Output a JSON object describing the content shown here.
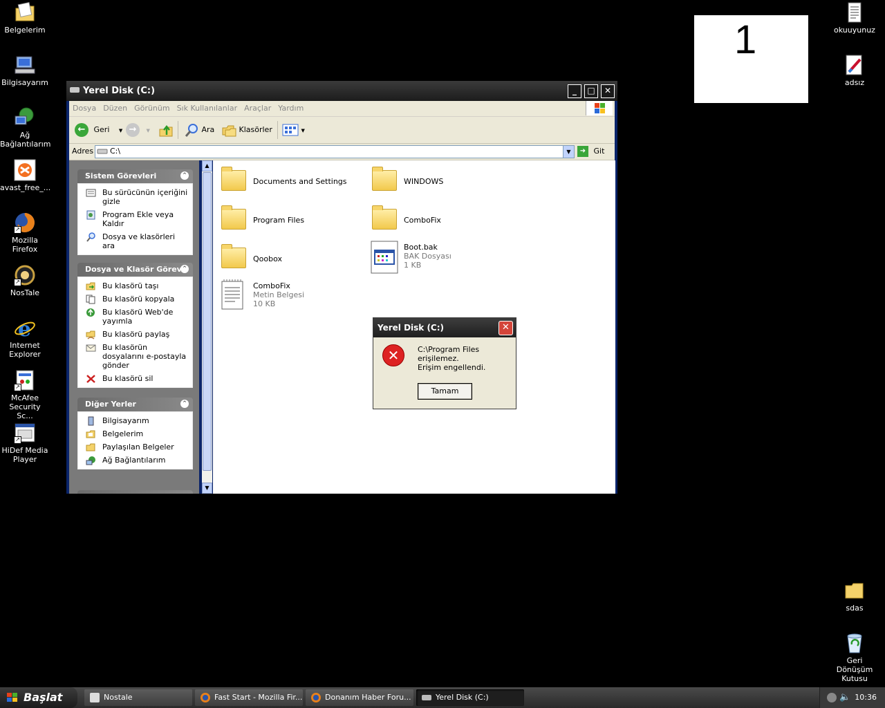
{
  "desktop": {
    "left_icons": [
      {
        "label": "Belgelerim",
        "icon": "my-documents-icon"
      },
      {
        "label": "Bilgisayarım",
        "icon": "my-computer-icon"
      },
      {
        "label": "Ağ Bağlantılarım",
        "icon": "network-icon"
      },
      {
        "label": "avast_free_...",
        "icon": "avast-icon"
      },
      {
        "label": "Mozilla Firefox",
        "icon": "firefox-icon"
      },
      {
        "label": "NosTale",
        "icon": "nostale-icon"
      },
      {
        "label": "Internet Explorer",
        "icon": "ie-icon"
      },
      {
        "label": "McAfee Security Sc...",
        "icon": "mcafee-icon"
      },
      {
        "label": "HiDef Media Player",
        "icon": "media-player-icon"
      }
    ],
    "right_icons": [
      {
        "label": "okuuyunuz",
        "icon": "text-file-icon"
      },
      {
        "label": "adsız",
        "icon": "paint-icon"
      },
      {
        "label": "sdas",
        "icon": "folder-icon"
      },
      {
        "label": "Geri Dönüşüm Kutusu",
        "icon": "recycle-bin-icon"
      }
    ],
    "counter": "1"
  },
  "explorer": {
    "title": "Yerel Disk (C:)",
    "menu": [
      "Dosya",
      "Düzen",
      "Görünüm",
      "Sık Kullanılanlar",
      "Araçlar",
      "Yardım"
    ],
    "toolbar": {
      "back": "Geri",
      "search": "Ara",
      "folders": "Klasörler"
    },
    "address": {
      "label": "Adres",
      "value": "C:\\",
      "go": "Git"
    },
    "panels": [
      {
        "title": "Sistem Görevleri",
        "items": [
          "Bu sürücünün içeriğini gizle",
          "Program Ekle veya Kaldır",
          "Dosya ve klasörleri ara"
        ]
      },
      {
        "title": "Dosya ve Klasör Görevl",
        "items": [
          "Bu klasörü taşı",
          "Bu klasörü kopyala",
          "Bu klasörü Web'de yayımla",
          "Bu klasörü paylaş",
          "Bu klasörün dosyalarını e-postayla gönder",
          "Bu klasörü sil"
        ]
      },
      {
        "title": "Diğer Yerler",
        "items": [
          "Bilgisayarım",
          "Belgelerim",
          "Paylaşılan Belgeler",
          "Ağ Bağlantılarım"
        ]
      }
    ],
    "files": [
      {
        "name": "Documents and Settings"
      },
      {
        "name": "WINDOWS"
      },
      {
        "name": "Program Files"
      },
      {
        "name": "ComboFix"
      },
      {
        "name": "Qoobox"
      },
      {
        "name": "Boot.bak",
        "type": "BAK Dosyası",
        "size": "1 KB"
      },
      {
        "name": "ComboFix",
        "type": "Metin Belgesi",
        "size": "10 KB"
      }
    ]
  },
  "dialog": {
    "title": "Yerel Disk (C:)",
    "line1": "C:\\Program Files erişilemez.",
    "line2": "Erişim engellendi.",
    "ok": "Tamam"
  },
  "taskbar": {
    "start": "Başlat",
    "tasks": [
      "Nostale",
      "Fast Start - Mozilla Fir...",
      "Donanım Haber Foru...",
      "Yerel Disk (C:)"
    ],
    "clock": "10:36"
  }
}
